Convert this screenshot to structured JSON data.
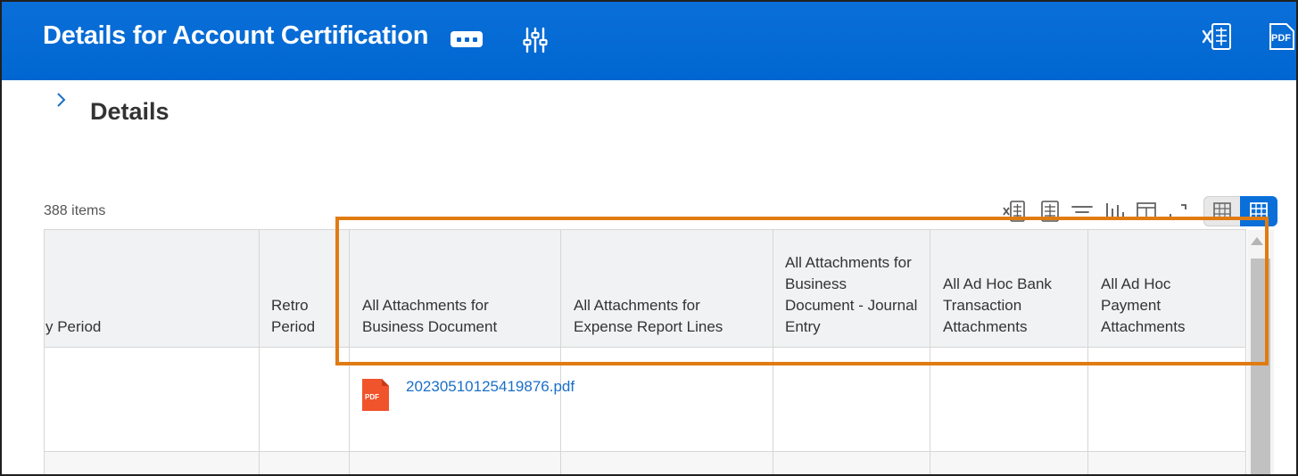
{
  "header": {
    "title": "Details for Account Certification",
    "icons": {
      "more": "more-icon",
      "related": "related-actions-icon",
      "excel": "export-excel-icon",
      "pdf": "export-pdf-icon"
    },
    "pdf_label": "PDF"
  },
  "section": {
    "title": "Details"
  },
  "list": {
    "count": "388 items"
  },
  "toolbar": {
    "icons": [
      "export-excel-icon",
      "export-table-icon",
      "filter-icon",
      "chart-icon",
      "columns-icon",
      "fullscreen-icon",
      "table-view-icon",
      "grid-view-icon"
    ]
  },
  "table": {
    "columns": [
      {
        "label": "y Period"
      },
      {
        "label": "Retro Period"
      },
      {
        "label": "All Attachments for Business Document"
      },
      {
        "label": "All Attachments for Expense Report Lines"
      },
      {
        "label": "All Attachments for Business Document - Journal Entry"
      },
      {
        "label": "All Ad Hoc Bank Transaction Attachments"
      },
      {
        "label": "All Ad Hoc Payment Attachments"
      }
    ],
    "rows": [
      {
        "attachment_file": "20230510125419876.pdf",
        "file_icon_label": "PDF"
      }
    ]
  },
  "colors": {
    "header_bg": "#0066d0",
    "highlight": "#e07b12",
    "link": "#1a6fc9"
  }
}
